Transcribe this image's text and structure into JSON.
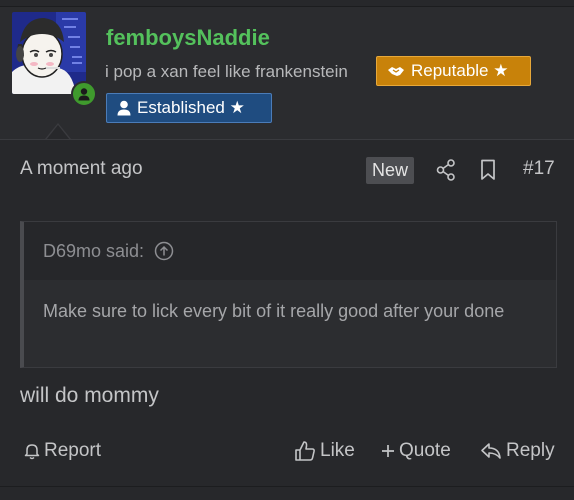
{
  "post": {
    "username": "femboysNaddie",
    "user_title": "i pop a xan feel like frankenstein",
    "badges": {
      "reputable": "Reputable ★",
      "established": "Established ★"
    },
    "time": "A moment ago",
    "new_label": "New",
    "post_number": "#17",
    "quote": {
      "author_line": "D69mo said:",
      "text": "Make sure to lick every bit of it really good after your done"
    },
    "message": "will do mommy",
    "actions": {
      "report": "Report",
      "like": "Like",
      "quote": "Quote",
      "reply": "Reply"
    }
  },
  "colors": {
    "username": "#54c15c",
    "reputable_badge": "#c8820a",
    "established_badge": "#1f4c80",
    "online": "#3f9a2d",
    "background": "#27282b"
  },
  "icons": [
    "handshake-icon",
    "user-icon",
    "share-icon",
    "bookmark-icon",
    "arrow-up-circle-icon",
    "bell-icon",
    "thumbs-up-icon",
    "plus-icon",
    "reply-icon",
    "user-online-icon"
  ]
}
